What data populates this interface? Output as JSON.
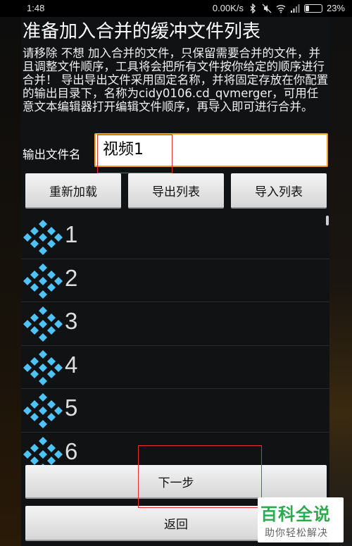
{
  "status_bar": {
    "time": "1:48",
    "network_speed": "0.00K/s",
    "battery": "23%",
    "battery_level": 0.23
  },
  "title": "准备加入合并的缓冲文件列表",
  "description": "请移除 不想 加入合并的文件，只保留需要合并的文件，并且调整文件顺序，工具将会把所有文件按你给定的顺序进行合并！ 导出导出文件采用固定名称，并将固定存放在你配置的输出目录下，名称为cidy0106.cd_qvmerger，可用任意文本编辑器打开编辑文件顺序，再导入即可进行合并。",
  "output": {
    "label": "输出文件名",
    "value": "视频1"
  },
  "buttons": {
    "reload": "重新加载",
    "export": "导出列表",
    "import": "导入列表",
    "next": "下一步",
    "back": "返回"
  },
  "files": [
    "1",
    "2",
    "3",
    "4",
    "5",
    "6"
  ],
  "watermark": {
    "brand": "百科全说",
    "slogan": "助你轻松解决"
  },
  "colors": {
    "icon_blue": "#4fc3f7",
    "input_border": "#f0a020",
    "highlight_red": "#e03030",
    "watermark_green": "#2fa84f"
  }
}
